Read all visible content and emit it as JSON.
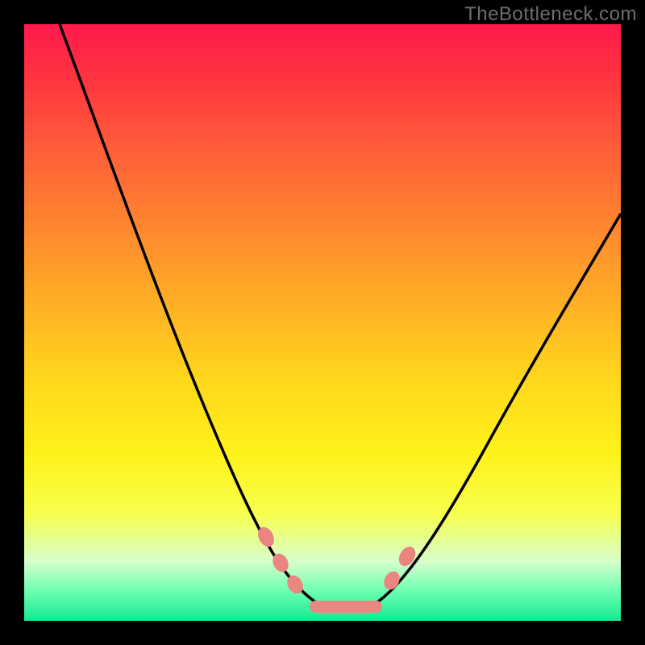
{
  "watermark": "TheBottleneck.com",
  "chart_data": {
    "type": "line",
    "title": "",
    "xlabel": "",
    "ylabel": "",
    "xlim": [
      0,
      100
    ],
    "ylim": [
      0,
      100
    ],
    "series": [
      {
        "name": "left-curve",
        "x": [
          6,
          10,
          15,
          20,
          25,
          30,
          35,
          38,
          40,
          42,
          44,
          46,
          48,
          50
        ],
        "values": [
          100,
          91,
          80,
          69,
          58,
          47,
          36,
          28,
          22,
          16,
          11,
          7,
          4,
          2
        ]
      },
      {
        "name": "right-curve",
        "x": [
          58,
          60,
          62,
          64,
          68,
          72,
          76,
          80,
          84,
          88,
          92,
          96,
          100
        ],
        "values": [
          2,
          4,
          6,
          9,
          15,
          22,
          29,
          36,
          43,
          50,
          57,
          63,
          68
        ]
      }
    ],
    "markers": [
      {
        "x": 40,
        "y": 14,
        "name": "left-dot-upper"
      },
      {
        "x": 42.5,
        "y": 10,
        "name": "left-dot-mid"
      },
      {
        "x": 45,
        "y": 6.5,
        "name": "left-dot-lower"
      },
      {
        "x": 61,
        "y": 7,
        "name": "right-dot-lower"
      },
      {
        "x": 63.5,
        "y": 11,
        "name": "right-dot-upper"
      }
    ],
    "trough_band": {
      "x_start": 47,
      "x_end": 59,
      "y": 2.5
    },
    "gradient_stops": [
      {
        "pos": 0.0,
        "color": "#ff1a4d",
        "meaning": "worst"
      },
      {
        "pos": 0.5,
        "color": "#ffd000",
        "meaning": "mid"
      },
      {
        "pos": 1.0,
        "color": "#16e893",
        "meaning": "best"
      }
    ]
  }
}
